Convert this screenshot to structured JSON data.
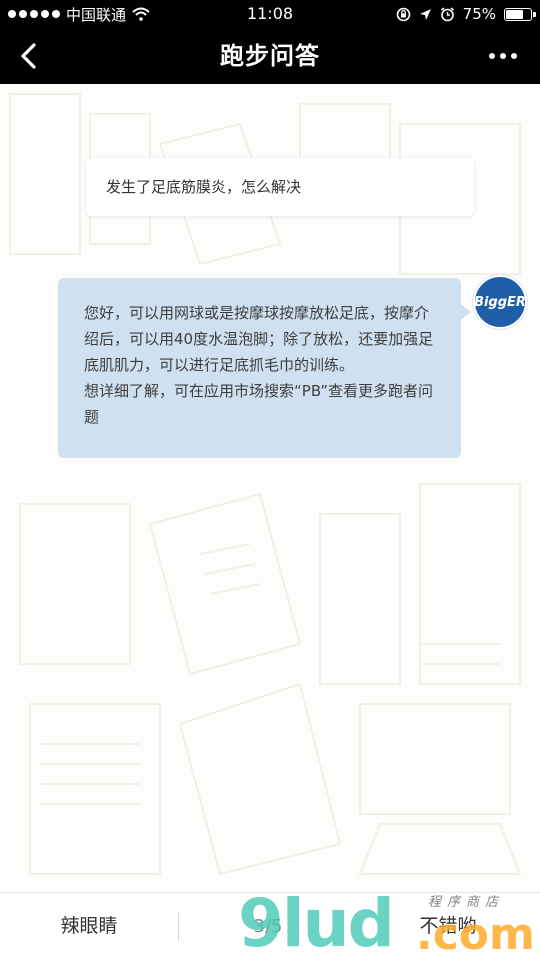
{
  "status_bar": {
    "carrier": "中国联通",
    "time": "11:08",
    "battery_percent": "75%",
    "battery_level": 0.75
  },
  "nav": {
    "title": "跑步问答"
  },
  "chat": {
    "question": "发生了足底筋膜炎，怎么解决",
    "answer_lines": [
      "您好，可以用网球或是按摩球按摩放松足底，按摩介绍后，可以用40度水温泡脚；除了放松，还要加强足底肌肌力，可以进行足底抓毛巾的训练。",
      "想详细了解，可在应用市场搜索“PB”查看更多跑者问题"
    ],
    "avatar_text": "BiggER"
  },
  "bottom_bar": {
    "left_label": "辣眼睛",
    "page_indicator": "3/5",
    "right_label": "不错哟"
  },
  "watermark": {
    "brand": "9lud",
    "domain": ".com",
    "tagline": "程序商店"
  },
  "colors": {
    "bar_background": "#000000",
    "answer_bubble": "#cfe0f0",
    "avatar": "#1f5fa8"
  }
}
